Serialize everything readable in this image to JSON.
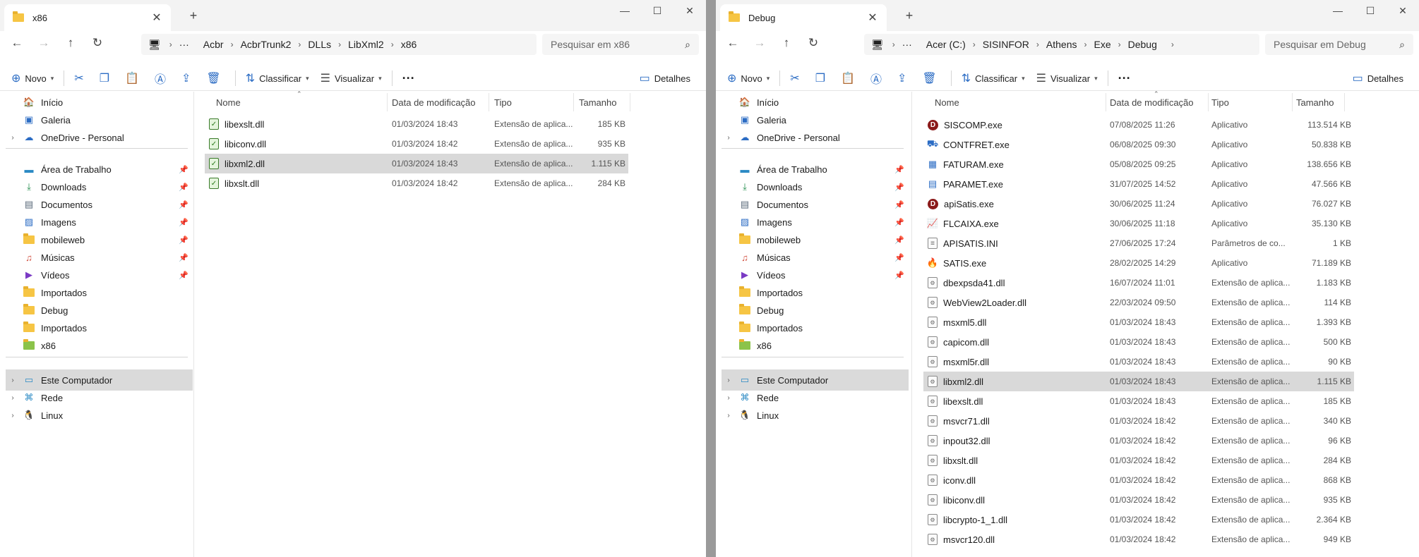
{
  "left_window": {
    "tab_title": "x86",
    "address": [
      "Acbr",
      "AcbrTrunk2",
      "DLLs",
      "LibXml2",
      "x86"
    ],
    "search_placeholder": "Pesquisar em x86",
    "toolbar": {
      "new": "Novo",
      "sort": "Classificar",
      "view": "Visualizar",
      "details": "Detalhes"
    },
    "columns": {
      "name": "Nome",
      "date": "Data de modificação",
      "type": "Tipo",
      "size": "Tamanho"
    },
    "files": [
      {
        "name": "libexslt.dll",
        "date": "01/03/2024 18:43",
        "type": "Extensão de aplica...",
        "size": "185 KB"
      },
      {
        "name": "libiconv.dll",
        "date": "01/03/2024 18:42",
        "type": "Extensão de aplica...",
        "size": "935 KB"
      },
      {
        "name": "libxml2.dll",
        "date": "01/03/2024 18:43",
        "type": "Extensão de aplica...",
        "size": "1.115 KB"
      },
      {
        "name": "libxslt.dll",
        "date": "01/03/2024 18:42",
        "type": "Extensão de aplica...",
        "size": "284 KB"
      }
    ],
    "selected_file": "libxml2.dll"
  },
  "right_window": {
    "tab_title": "Debug",
    "address": [
      "Acer (C:)",
      "SISINFOR",
      "Athens",
      "Exe",
      "Debug"
    ],
    "search_placeholder": "Pesquisar em Debug",
    "toolbar": {
      "new": "Novo",
      "sort": "Classificar",
      "view": "Visualizar",
      "details": "Detalhes"
    },
    "columns": {
      "name": "Nome",
      "date": "Data de modificação",
      "type": "Tipo",
      "size": "Tamanho"
    },
    "files": [
      {
        "name": "SISCOMP.exe",
        "date": "07/08/2025 11:26",
        "type": "Aplicativo",
        "size": "113.514 KB",
        "icon": "d-red-icon"
      },
      {
        "name": "CONTFRET.exe",
        "date": "06/08/2025 09:30",
        "type": "Aplicativo",
        "size": "50.838 KB",
        "icon": "truck-icon"
      },
      {
        "name": "FATURAM.exe",
        "date": "05/08/2025 09:25",
        "type": "Aplicativo",
        "size": "138.656 KB",
        "icon": "register-icon"
      },
      {
        "name": "PARAMET.exe",
        "date": "31/07/2025 14:52",
        "type": "Aplicativo",
        "size": "47.566 KB",
        "icon": "document-blue-icon"
      },
      {
        "name": "apiSatis.exe",
        "date": "30/06/2025 11:24",
        "type": "Aplicativo",
        "size": "76.027 KB",
        "icon": "d-red-icon"
      },
      {
        "name": "FLCAIXA.exe",
        "date": "30/06/2025 11:18",
        "type": "Aplicativo",
        "size": "35.130 KB",
        "icon": "chart-icon"
      },
      {
        "name": "APISATIS.INI",
        "date": "27/06/2025 17:24",
        "type": "Parâmetros de co...",
        "size": "1 KB",
        "icon": "ini-icon"
      },
      {
        "name": "SATIS.exe",
        "date": "28/02/2025 14:29",
        "type": "Aplicativo",
        "size": "71.189 KB",
        "icon": "satis-icon"
      },
      {
        "name": "dbexpsda41.dll",
        "date": "16/07/2024 11:01",
        "type": "Extensão de aplica...",
        "size": "1.183 KB",
        "icon": "dll-icon"
      },
      {
        "name": "WebView2Loader.dll",
        "date": "22/03/2024 09:50",
        "type": "Extensão de aplica...",
        "size": "114 KB",
        "icon": "dll-icon"
      },
      {
        "name": "msxml5.dll",
        "date": "01/03/2024 18:43",
        "type": "Extensão de aplica...",
        "size": "1.393 KB",
        "icon": "dll-icon"
      },
      {
        "name": "capicom.dll",
        "date": "01/03/2024 18:43",
        "type": "Extensão de aplica...",
        "size": "500 KB",
        "icon": "dll-icon"
      },
      {
        "name": "msxml5r.dll",
        "date": "01/03/2024 18:43",
        "type": "Extensão de aplica...",
        "size": "90 KB",
        "icon": "dll-icon"
      },
      {
        "name": "libxml2.dll",
        "date": "01/03/2024 18:43",
        "type": "Extensão de aplica...",
        "size": "1.115 KB",
        "icon": "dll-icon"
      },
      {
        "name": "libexslt.dll",
        "date": "01/03/2024 18:43",
        "type": "Extensão de aplica...",
        "size": "185 KB",
        "icon": "dll-icon"
      },
      {
        "name": "msvcr71.dll",
        "date": "01/03/2024 18:42",
        "type": "Extensão de aplica...",
        "size": "340 KB",
        "icon": "dll-icon"
      },
      {
        "name": "inpout32.dll",
        "date": "01/03/2024 18:42",
        "type": "Extensão de aplica...",
        "size": "96 KB",
        "icon": "dll-icon"
      },
      {
        "name": "libxslt.dll",
        "date": "01/03/2024 18:42",
        "type": "Extensão de aplica...",
        "size": "284 KB",
        "icon": "dll-icon"
      },
      {
        "name": "iconv.dll",
        "date": "01/03/2024 18:42",
        "type": "Extensão de aplica...",
        "size": "868 KB",
        "icon": "dll-icon"
      },
      {
        "name": "libiconv.dll",
        "date": "01/03/2024 18:42",
        "type": "Extensão de aplica...",
        "size": "935 KB",
        "icon": "dll-icon"
      },
      {
        "name": "libcrypto-1_1.dll",
        "date": "01/03/2024 18:42",
        "type": "Extensão de aplica...",
        "size": "2.364 KB",
        "icon": "dll-icon"
      },
      {
        "name": "msvcr120.dll",
        "date": "01/03/2024 18:42",
        "type": "Extensão de aplica...",
        "size": "949 KB",
        "icon": "dll-icon"
      }
    ],
    "selected_file": "libxml2.dll"
  },
  "sidebar": {
    "top": [
      {
        "label": "Início",
        "icon": "home-icon"
      },
      {
        "label": "Galeria",
        "icon": "gallery-icon"
      },
      {
        "label": "OneDrive - Personal",
        "icon": "cloud-icon",
        "expandable": true
      }
    ],
    "pinned": [
      {
        "label": "Área de Trabalho",
        "icon": "desktop-icon",
        "pinned": true
      },
      {
        "label": "Downloads",
        "icon": "download-icon",
        "pinned": true
      },
      {
        "label": "Documentos",
        "icon": "documents-icon",
        "pinned": true
      },
      {
        "label": "Imagens",
        "icon": "images-icon",
        "pinned": true
      },
      {
        "label": "mobileweb",
        "icon": "folder-icon",
        "pinned": true
      },
      {
        "label": "Músicas",
        "icon": "music-icon",
        "pinned": true
      },
      {
        "label": "Vídeos",
        "icon": "videos-icon",
        "pinned": true
      },
      {
        "label": "Importados",
        "icon": "folder-icon",
        "pinned": false
      },
      {
        "label": "Debug",
        "icon": "folder-icon",
        "pinned": false
      },
      {
        "label": "Importados",
        "icon": "folder-icon",
        "pinned": false
      },
      {
        "label": "x86",
        "icon": "dll-folder-icon",
        "pinned": false
      }
    ],
    "bottom": [
      {
        "label": "Este Computador",
        "icon": "computer-icon",
        "selected": true
      },
      {
        "label": "Rede",
        "icon": "network-icon"
      },
      {
        "label": "Linux",
        "icon": "linux-icon"
      }
    ]
  },
  "colors": {
    "accent": "#2b6cc4",
    "selection": "#d9d9d9",
    "folder": "#f6c544"
  }
}
